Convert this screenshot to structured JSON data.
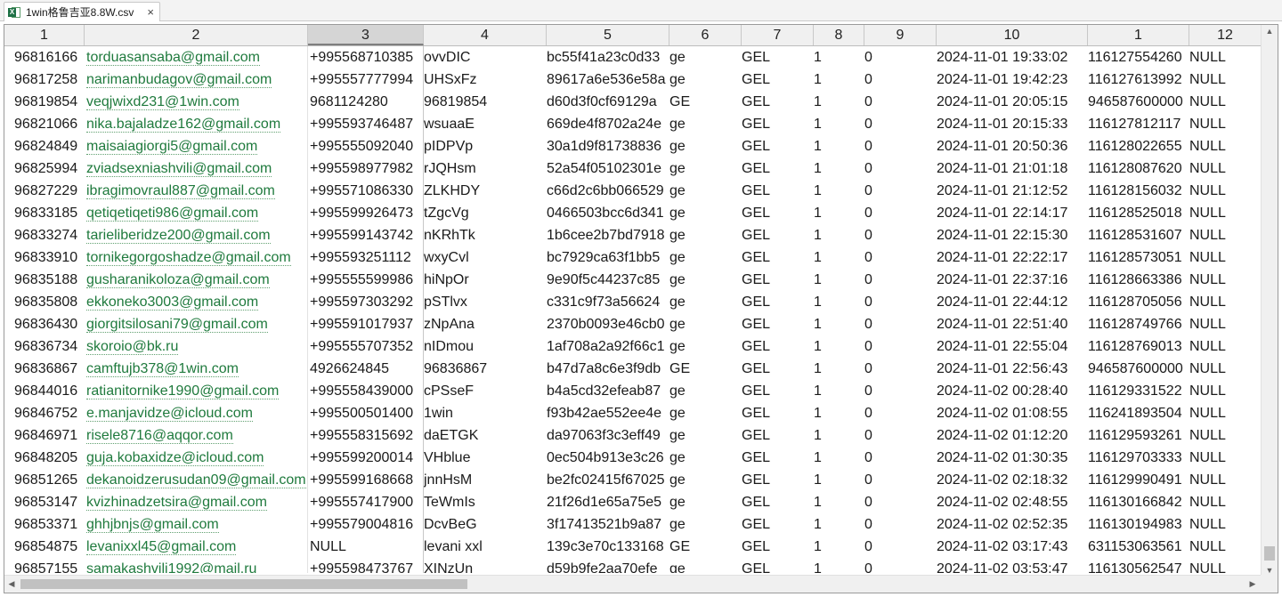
{
  "tab": {
    "icon": "excel-file-icon",
    "icon_letter": "X",
    "title": "1win格鲁吉亚8.8W.csv",
    "close": "×"
  },
  "columns": [
    "1",
    "2",
    "3",
    "4",
    "5",
    "6",
    "7",
    "8",
    "9",
    "10",
    "1",
    "12"
  ],
  "active_column_index": 2,
  "rows": [
    [
      "96816166",
      "torduasansaba@gmail.com",
      "+995568710385",
      "ovvDIC",
      "bc55f41a23c0d33",
      "ge",
      "GEL",
      "1",
      "0",
      "2024-11-01 19:33:02",
      "116127554260",
      "NULL"
    ],
    [
      "96817258",
      "narimanbudagov@gmail.com",
      "+995557777994",
      "UHSxFz",
      "89617a6e536e58a",
      "ge",
      "GEL",
      "1",
      "0",
      "2024-11-01 19:42:23",
      "116127613992",
      "NULL"
    ],
    [
      "96819854",
      "veqjwixd231@1win.com",
      "9681124280",
      "96819854",
      "d60d3f0cf69129a",
      "GE",
      "GEL",
      "1",
      "0",
      "2024-11-01 20:05:15",
      "946587600000",
      "NULL"
    ],
    [
      "96821066",
      "nika.bajaladze162@gmail.com",
      "+995593746487",
      "wsuaaE",
      "669de4f8702a24e",
      "ge",
      "GEL",
      "1",
      "0",
      "2024-11-01 20:15:33",
      "116127812117",
      "NULL"
    ],
    [
      "96824849",
      "maisaiagiorgi5@gmail.com",
      "+995555092040",
      "pIDPVp",
      "30a1d9f81738836",
      "ge",
      "GEL",
      "1",
      "0",
      "2024-11-01 20:50:36",
      "116128022655",
      "NULL"
    ],
    [
      "96825994",
      "zviadsexniashvili@gmail.com",
      "+995598977982",
      "rJQHsm",
      "52a54f05102301e",
      "ge",
      "GEL",
      "1",
      "0",
      "2024-11-01 21:01:18",
      "116128087620",
      "NULL"
    ],
    [
      "96827229",
      "ibragimovraul887@gmail.com",
      "+995571086330",
      "ZLKHDY",
      "c66d2c6bb066529",
      "ge",
      "GEL",
      "1",
      "0",
      "2024-11-01 21:12:52",
      "116128156032",
      "NULL"
    ],
    [
      "96833185",
      "qetiqetiqeti986@gmail.com",
      "+995599926473",
      "tZgcVg",
      "0466503bcc6d341",
      "ge",
      "GEL",
      "1",
      "0",
      "2024-11-01 22:14:17",
      "116128525018",
      "NULL"
    ],
    [
      "96833274",
      "tarieliberidze200@gmail.com",
      "+995599143742",
      "nKRhTk",
      "1b6cee2b7bd7918",
      "ge",
      "GEL",
      "1",
      "0",
      "2024-11-01 22:15:30",
      "116128531607",
      "NULL"
    ],
    [
      "96833910",
      "tornikegorgoshadze@gmail.com",
      "+995593251112",
      "wxyCvl",
      "bc7929ca63f1bb5",
      "ge",
      "GEL",
      "1",
      "0",
      "2024-11-01 22:22:17",
      "116128573051",
      "NULL"
    ],
    [
      "96835188",
      "gusharanikoloza@gmail.com",
      "+995555599986",
      "hiNpOr",
      "9e90f5c44237c85",
      "ge",
      "GEL",
      "1",
      "0",
      "2024-11-01 22:37:16",
      "116128663386",
      "NULL"
    ],
    [
      "96835808",
      "ekkoneko3003@gmail.com",
      "+995597303292",
      "pSTlvx",
      "c331c9f73a56624",
      "ge",
      "GEL",
      "1",
      "0",
      "2024-11-01 22:44:12",
      "116128705056",
      "NULL"
    ],
    [
      "96836430",
      "giorgitsilosani79@gmail.com",
      "+995591017937",
      "zNpAna",
      "2370b0093e46cb0",
      "ge",
      "GEL",
      "1",
      "0",
      "2024-11-01 22:51:40",
      "116128749766",
      "NULL"
    ],
    [
      "96836734",
      "skoroio@bk.ru",
      "+995555707352",
      "nIDmou",
      "1af708a2a92f66c1",
      "ge",
      "GEL",
      "1",
      "0",
      "2024-11-01 22:55:04",
      "116128769013",
      "NULL"
    ],
    [
      "96836867",
      "camftujb378@1win.com",
      "4926624845",
      "96836867",
      "b47d7a8c6e3f9db",
      "GE",
      "GEL",
      "1",
      "0",
      "2024-11-01 22:56:43",
      "946587600000",
      "NULL"
    ],
    [
      "96844016",
      "ratianitornike1990@gmail.com",
      "+995558439000",
      "cPSseF",
      "b4a5cd32efeab87",
      "ge",
      "GEL",
      "1",
      "0",
      "2024-11-02 00:28:40",
      "116129331522",
      "NULL"
    ],
    [
      "96846752",
      "e.manjavidze@icloud.com",
      "+995500501400",
      "1win",
      "f93b42ae552ee4e",
      "ge",
      "GEL",
      "1",
      "0",
      "2024-11-02 01:08:55",
      "116241893504",
      "NULL"
    ],
    [
      "96846971",
      "risele8716@aqqor.com",
      "+995558315692",
      "daETGK",
      "da97063f3c3eff49",
      "ge",
      "GEL",
      "1",
      "0",
      "2024-11-02 01:12:20",
      "116129593261",
      "NULL"
    ],
    [
      "96848205",
      "guja.kobaxidze@icloud.com",
      "+995599200014",
      "VHblue",
      "0ec504b913e3c26",
      "ge",
      "GEL",
      "1",
      "0",
      "2024-11-02 01:30:35",
      "116129703333",
      "NULL"
    ],
    [
      "96851265",
      "dekanoidzerusudan09@gmail.com",
      "+995599168668",
      "jnnHsM",
      "be2fc02415f67025",
      "ge",
      "GEL",
      "1",
      "0",
      "2024-11-02 02:18:32",
      "116129990491",
      "NULL"
    ],
    [
      "96853147",
      "kvizhinadzetsira@gmail.com",
      "+995557417900",
      "TeWmIs",
      "21f26d1e65a75e5",
      "ge",
      "GEL",
      "1",
      "0",
      "2024-11-02 02:48:55",
      "116130166842",
      "NULL"
    ],
    [
      "96853371",
      "ghhjbnjs@gmail.com",
      "+995579004816",
      "DcvBeG",
      "3f17413521b9a87",
      "ge",
      "GEL",
      "1",
      "0",
      "2024-11-02 02:52:35",
      "116130194983",
      "NULL"
    ],
    [
      "96854875",
      "levanixxl45@gmail.com",
      "NULL",
      "levani xxl",
      "139c3e70c133168",
      "GE",
      "GEL",
      "1",
      "0",
      "2024-11-02 03:17:43",
      "631153063561",
      "NULL"
    ],
    [
      "96857155",
      "samakashvili1992@mail.ru",
      "+995598473767",
      "XINzUn",
      "d59b9fe2aa70efe",
      "ge",
      "GEL",
      "1",
      "0",
      "2024-11-02 03:53:47",
      "116130562547",
      "NULL"
    ]
  ],
  "scroll": {
    "up_arrow": "▲",
    "down_arrow": "▼",
    "left_arrow": "◀",
    "right_arrow": "▶"
  }
}
